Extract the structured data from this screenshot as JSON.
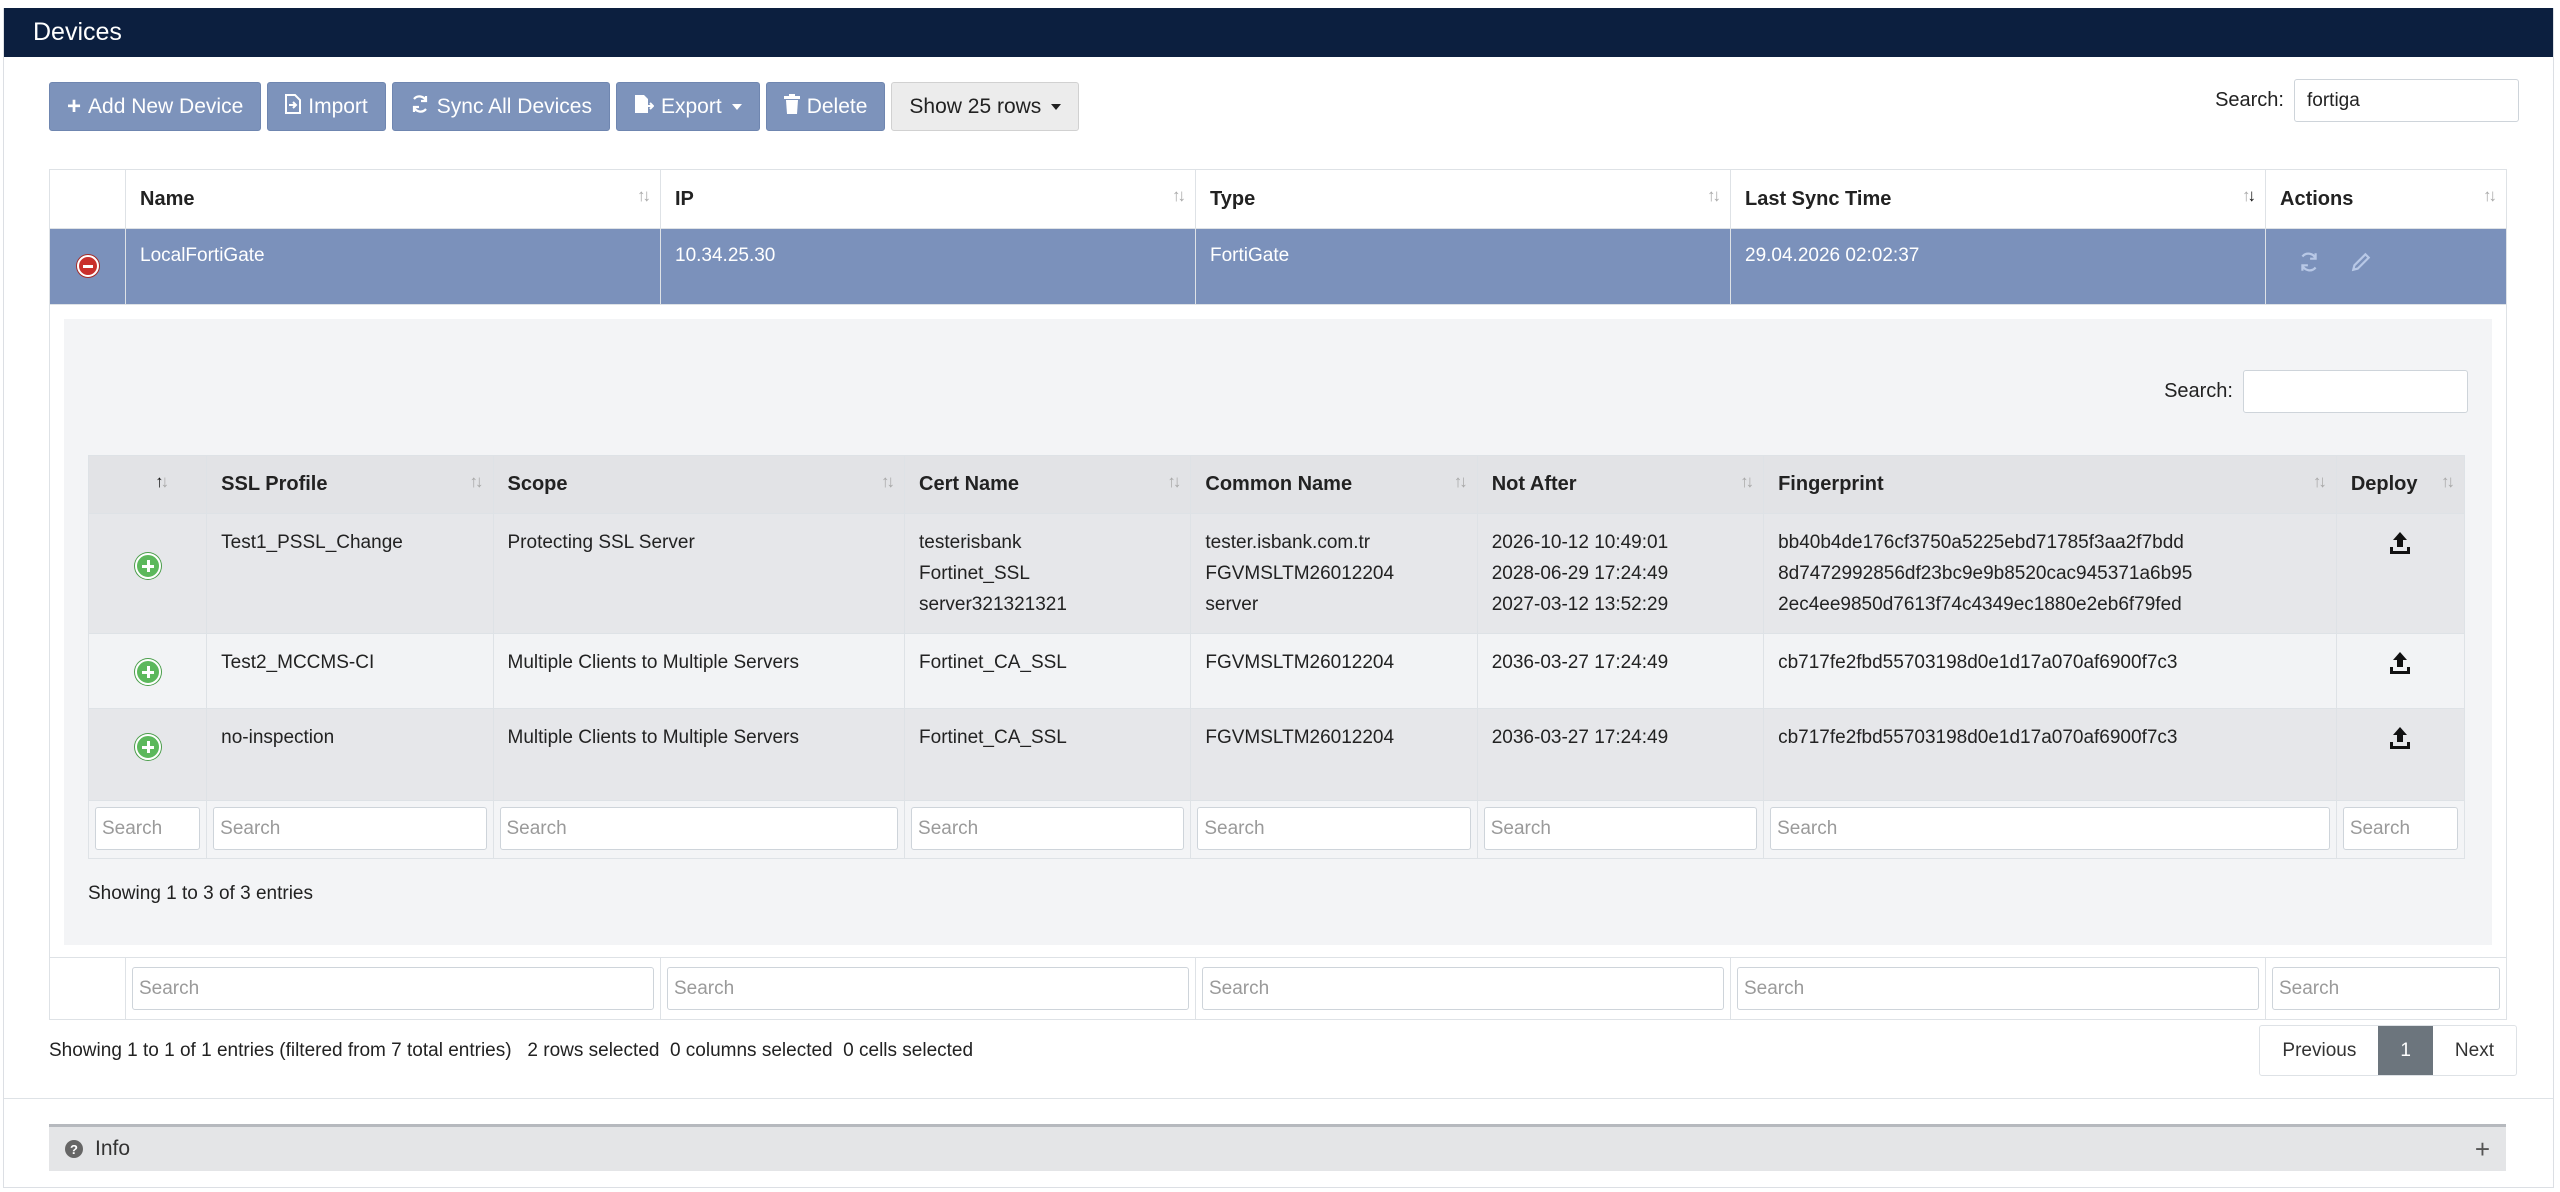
{
  "title": "Devices",
  "toolbar": {
    "add": "Add New Device",
    "import": "Import",
    "sync": "Sync All Devices",
    "export": "Export",
    "delete": "Delete",
    "rows": "Show 25 rows"
  },
  "search": {
    "label": "Search:",
    "value": "fortiga"
  },
  "main_table": {
    "columns": [
      "Name",
      "IP",
      "Type",
      "Last Sync Time",
      "Actions"
    ],
    "row": {
      "name": "LocalFortiGate",
      "ip": "10.34.25.30",
      "type": "FortiGate",
      "last_sync": "29.04.2026 02:02:37"
    }
  },
  "inner": {
    "search_label": "Search:",
    "columns": [
      "SSL Profile",
      "Scope",
      "Cert Name",
      "Common Name",
      "Not After",
      "Fingerprint",
      "Deploy"
    ],
    "rows": [
      {
        "profile": "Test1_PSSL_Change",
        "scope": "Protecting SSL Server",
        "cert": [
          "testerisbank",
          "Fortinet_SSL",
          "server321321321"
        ],
        "cn": [
          "tester.isbank.com.tr",
          "FGVMSLTM26012204",
          "server"
        ],
        "not_after": [
          "2026-10-12 10:49:01",
          "2028-06-29 17:24:49",
          "2027-03-12 13:52:29"
        ],
        "fp": [
          "bb40b4de176cf3750a5225ebd71785f3aa2f7bdd",
          "8d7472992856df23bc9e9b8520cac945371a6b95",
          "2ec4ee9850d7613f74c4349ec1880e2eb6f79fed"
        ]
      },
      {
        "profile": "Test2_MCCMS-CI",
        "scope": "Multiple Clients to Multiple Servers",
        "cert": [
          "Fortinet_CA_SSL"
        ],
        "cn": [
          "FGVMSLTM26012204"
        ],
        "not_after": [
          "2036-03-27 17:24:49"
        ],
        "fp": [
          "cb717fe2fbd55703198d0e1d17a070af6900f7c3"
        ]
      },
      {
        "profile": "no-inspection",
        "scope": "Multiple Clients to Multiple Servers",
        "cert": [
          "Fortinet_CA_SSL"
        ],
        "cn": [
          "FGVMSLTM26012204"
        ],
        "not_after": [
          "2036-03-27 17:24:49"
        ],
        "fp": [
          "cb717fe2fbd55703198d0e1d17a070af6900f7c3"
        ]
      }
    ],
    "search_placeholder": "Search",
    "showing": "Showing 1 to 3 of 3 entries"
  },
  "footer": {
    "search_placeholder": "Search",
    "status": "Showing 1 to 1 of 1 entries (filtered from 7 total entries)   2 rows selected  0 columns selected  0 cells selected",
    "prev": "Previous",
    "page": "1",
    "next": "Next"
  },
  "info": {
    "label": "Info"
  },
  "colors": {
    "header": "#0c1f3f",
    "button": "#7d93bb",
    "selected_row": "#7b91bb"
  },
  "icons": {
    "add": "plus-icon",
    "import": "import-icon",
    "sync": "sync-icon",
    "export": "export-icon",
    "delete": "trash-icon",
    "deploy": "upload-icon",
    "info": "question-icon",
    "expand": "plus-icon"
  }
}
